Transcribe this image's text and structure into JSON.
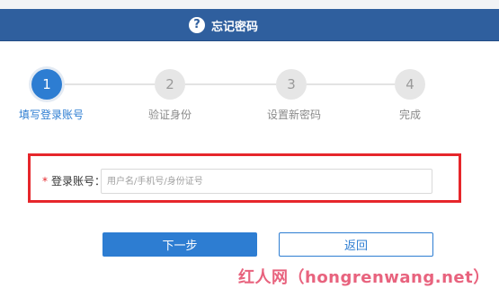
{
  "header": {
    "title": "忘记密码",
    "help_icon": "question-circle-icon"
  },
  "steps": [
    {
      "number": "1",
      "label": "填写登录账号",
      "active": true
    },
    {
      "number": "2",
      "label": "验证身份",
      "active": false
    },
    {
      "number": "3",
      "label": "设置新密码",
      "active": false
    },
    {
      "number": "4",
      "label": "完成",
      "active": false
    }
  ],
  "form": {
    "required_mark": "*",
    "account_label": "登录账号：",
    "account_value": "",
    "account_placeholder": "用户名/手机号/身份证号"
  },
  "buttons": {
    "next": "下一步",
    "back": "返回"
  },
  "watermark": "红人网（hongrenwang.net）",
  "colors": {
    "header": "#2f5f9e",
    "primary": "#2d7dd2",
    "highlight": "#e6262b",
    "inactive": "#e6e6e6"
  }
}
